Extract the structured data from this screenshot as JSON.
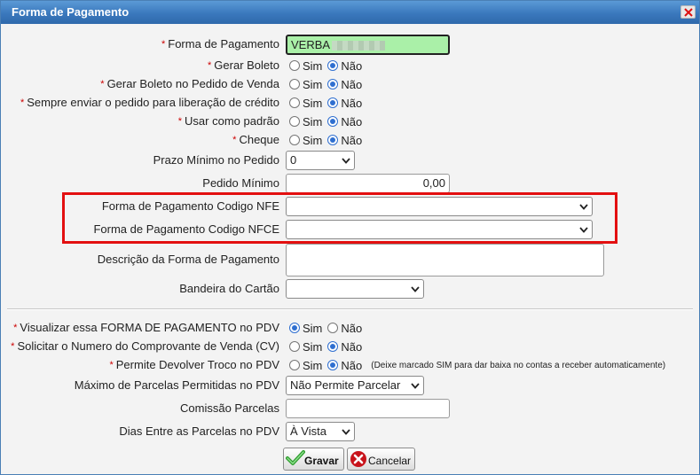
{
  "window": {
    "title": "Forma de Pagamento",
    "close_icon": "close-icon"
  },
  "required_mark": "*",
  "fields": {
    "forma_pagamento": {
      "label": "Forma de Pagamento",
      "value": "VERBA"
    },
    "gerar_boleto": {
      "label": "Gerar Boleto",
      "sim": "Sim",
      "nao": "Não",
      "selected": "Não"
    },
    "gerar_boleto_pedido": {
      "label": "Gerar Boleto no Pedido de Venda",
      "sim": "Sim",
      "nao": "Não",
      "selected": "Não"
    },
    "sempre_enviar": {
      "label": "Sempre enviar o pedido para liberação de crédito",
      "sim": "Sim",
      "nao": "Não",
      "selected": "Não"
    },
    "usar_padrao": {
      "label": "Usar como padrão",
      "sim": "Sim",
      "nao": "Não",
      "selected": "Não"
    },
    "cheque": {
      "label": "Cheque",
      "sim": "Sim",
      "nao": "Não",
      "selected": "Não"
    },
    "prazo_minimo": {
      "label": "Prazo Mínimo no Pedido",
      "value": "0"
    },
    "pedido_minimo": {
      "label": "Pedido Mínimo",
      "value": "0,00"
    },
    "codigo_nfe": {
      "label": "Forma de Pagamento Codigo NFE",
      "value": ""
    },
    "codigo_nfce": {
      "label": "Forma de Pagamento Codigo NFCE",
      "value": ""
    },
    "descricao": {
      "label": "Descrição da Forma de Pagamento",
      "value": ""
    },
    "bandeira": {
      "label": "Bandeira do Cartão",
      "value": ""
    },
    "visualizar_pdv": {
      "label": "Visualizar essa FORMA DE PAGAMENTO no PDV",
      "sim": "Sim",
      "nao": "Não",
      "selected": "Sim"
    },
    "solicitar_cv": {
      "label": "Solicitar o Numero do Comprovante de Venda (CV)",
      "sim": "Sim",
      "nao": "Não",
      "selected": "Não"
    },
    "devolver_troco": {
      "label": "Permite Devolver Troco no PDV",
      "sim": "Sim",
      "nao": "Não",
      "selected": "Não",
      "note": "(Deixe marcado SIM para dar baixa no contas a receber automaticamente)"
    },
    "maximo_parcelas": {
      "label": "Máximo de Parcelas Permitidas no PDV",
      "value": "Não Permite Parcelar"
    },
    "comissao_parcelas": {
      "label": "Comissão Parcelas",
      "value": ""
    },
    "dias_parcelas": {
      "label": "Dias Entre as Parcelas no PDV",
      "value": "À Vista"
    }
  },
  "buttons": {
    "gravar": {
      "label": "Gravar",
      "icon": "check-icon"
    },
    "cancelar": {
      "label": "Cancelar",
      "icon": "cancel-icon"
    }
  },
  "colors": {
    "title_bar": "#3a78bd",
    "highlight": "#e30f10",
    "input_green": "#aaf0a8",
    "radio_accent": "#2f6fd0"
  }
}
